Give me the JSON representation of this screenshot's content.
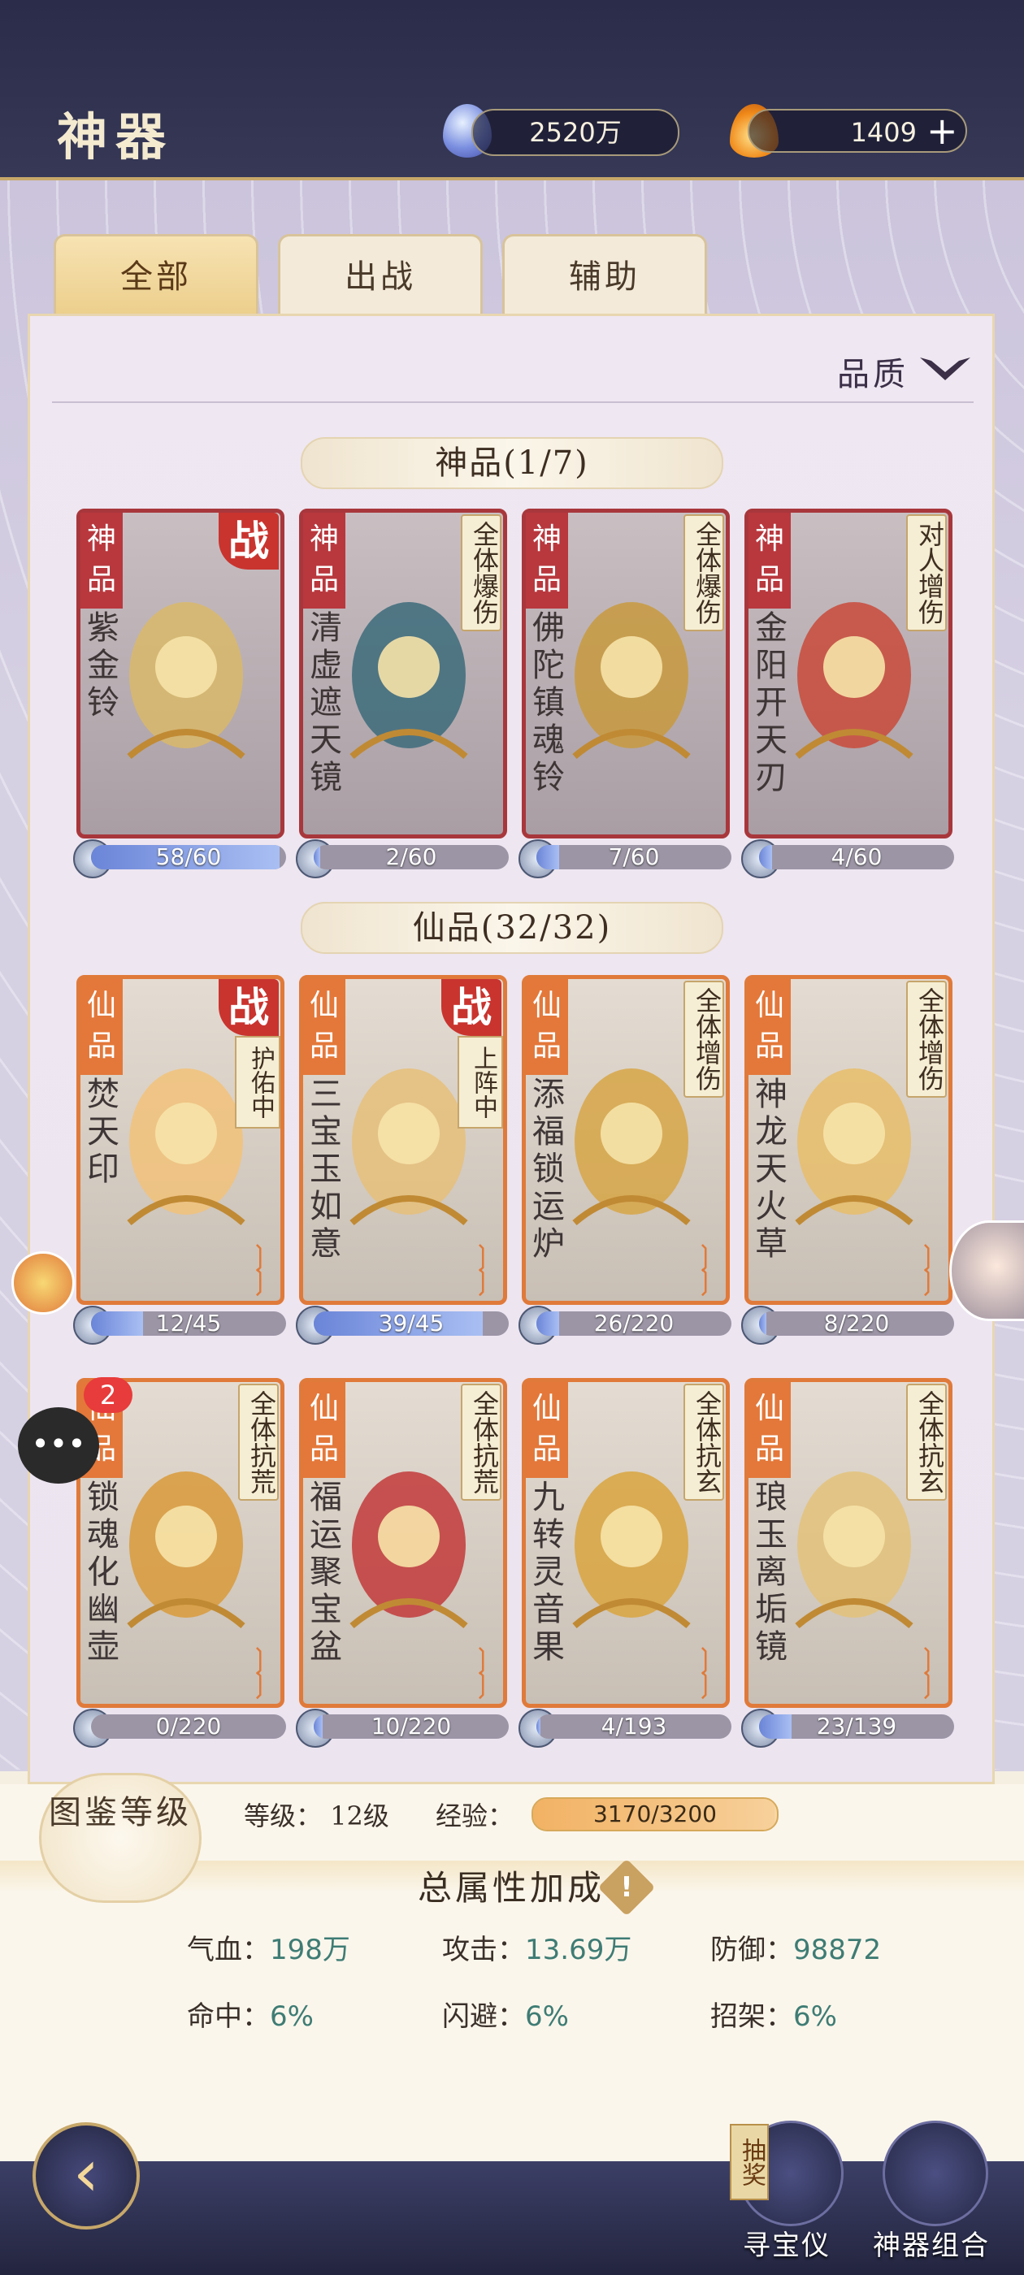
{
  "header": {
    "title": "神器",
    "currency1": "2520万",
    "currency2": "1409",
    "currency1_icon": "spirit-gem-icon",
    "currency2_icon": "flame-icon"
  },
  "tabs": [
    {
      "label": "全部",
      "active": true
    },
    {
      "label": "出战",
      "active": false
    },
    {
      "label": "辅助",
      "active": false
    }
  ],
  "filter": {
    "label": "品质"
  },
  "sections": [
    {
      "title": "神品(1/7)",
      "cards": [
        {
          "grade": "神品",
          "name": "紫金铃",
          "tag": "",
          "in_battle": true,
          "deploy": "",
          "progress": "58/60",
          "fraction": 0.967
        },
        {
          "grade": "神品",
          "name": "清虚遮天镜",
          "tag": "全体爆伤",
          "in_battle": false,
          "deploy": "",
          "progress": "2/60",
          "fraction": 0.033
        },
        {
          "grade": "神品",
          "name": "佛陀镇魂铃",
          "tag": "全体爆伤",
          "in_battle": false,
          "deploy": "",
          "progress": "7/60",
          "fraction": 0.117
        },
        {
          "grade": "神品",
          "name": "金阳开天刃",
          "tag": "对人增伤",
          "in_battle": false,
          "deploy": "",
          "progress": "4/60",
          "fraction": 0.067
        }
      ]
    },
    {
      "title": "仙品(32/32)",
      "cards": [
        {
          "grade": "仙品",
          "name": "焚天印",
          "tag": "",
          "in_battle": true,
          "deploy": "护佑中",
          "progress": "12/45",
          "fraction": 0.267
        },
        {
          "grade": "仙品",
          "name": "三宝玉如意",
          "tag": "",
          "in_battle": true,
          "deploy": "上阵中",
          "progress": "39/45",
          "fraction": 0.867
        },
        {
          "grade": "仙品",
          "name": "添福锁运炉",
          "tag": "全体增伤",
          "in_battle": false,
          "deploy": "",
          "progress": "26/220",
          "fraction": 0.118
        },
        {
          "grade": "仙品",
          "name": "神龙天火草",
          "tag": "全体增伤",
          "in_battle": false,
          "deploy": "",
          "progress": "8/220",
          "fraction": 0.036
        },
        {
          "grade": "仙品",
          "name": "锁魂化幽壶",
          "tag": "全体抗荒",
          "in_battle": false,
          "deploy": "",
          "badge": "2",
          "progress": "0/220",
          "fraction": 0.0
        },
        {
          "grade": "仙品",
          "name": "福运聚宝盆",
          "tag": "全体抗荒",
          "in_battle": false,
          "deploy": "",
          "progress": "10/220",
          "fraction": 0.045
        },
        {
          "grade": "仙品",
          "name": "九转灵音果",
          "tag": "全体抗玄",
          "in_battle": false,
          "deploy": "",
          "progress": "4/193",
          "fraction": 0.021
        },
        {
          "grade": "仙品",
          "name": "琅玉离垢镜",
          "tag": "全体抗玄",
          "in_battle": false,
          "deploy": "",
          "progress": "23/139",
          "fraction": 0.165
        }
      ]
    }
  ],
  "battle_mark": "战",
  "atlas": {
    "label": "图鉴等级",
    "level_label": "等级：",
    "level_value": "12级",
    "exp_label": "经验：",
    "exp_value": "3170/3200",
    "exp_fraction": 0.991
  },
  "bonus": {
    "title": "总属性加成",
    "stats": [
      {
        "label": "气血：",
        "value": "198万"
      },
      {
        "label": "攻击：",
        "value": "13.69万"
      },
      {
        "label": "防御：",
        "value": "98872"
      },
      {
        "label": "命中：",
        "value": "6%"
      },
      {
        "label": "闪避：",
        "value": "6%"
      },
      {
        "label": "招架：",
        "value": "6%"
      }
    ]
  },
  "chat": {
    "icon": "chat-bubble-icon",
    "glyph": "•••"
  },
  "nav": {
    "lottery": "抽奖",
    "treasure": "寻宝仪",
    "combo": "神器组合"
  }
}
